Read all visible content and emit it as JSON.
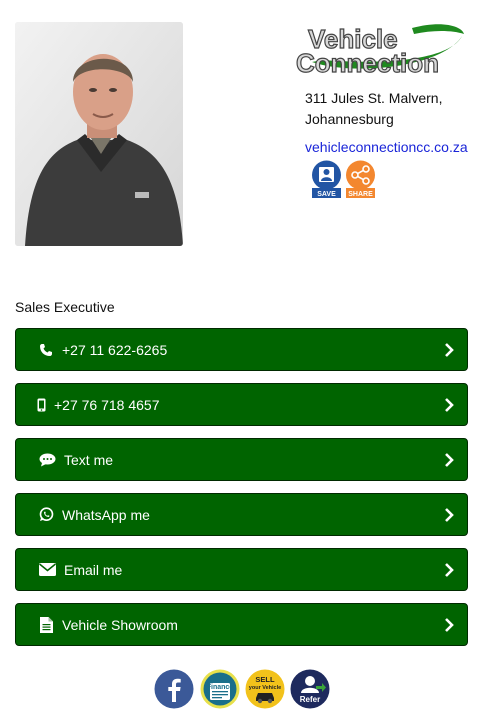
{
  "brand": {
    "logo_line1": "Vehicle",
    "logo_line2": "Connection"
  },
  "contact": {
    "address_line1": "311 Jules St. Malvern,",
    "address_line2": "Johannesburg",
    "website": "vehicleconnectioncc.co.za",
    "save_label": "SAVE",
    "share_label": "SHARE",
    "role": "Sales Executive"
  },
  "buttons": [
    {
      "label": "+27 11 622-6265",
      "icon": "phone-icon"
    },
    {
      "label": "+27 76 718 4657",
      "icon": "mobile-icon"
    },
    {
      "label": "Text me",
      "icon": "chat-icon"
    },
    {
      "label": "WhatsApp me",
      "icon": "whatsapp-icon"
    },
    {
      "label": "Email me",
      "icon": "envelope-icon"
    },
    {
      "label": "Vehicle Showroom",
      "icon": "document-icon"
    }
  ],
  "footer": {
    "finance_label": "Finance",
    "sell_label_1": "SELL",
    "sell_label_2": "your Vehicle",
    "refer_label": "Refer"
  },
  "colors": {
    "button_green": "#006400",
    "link_blue": "#1a25d8",
    "facebook_blue": "#3b5998"
  }
}
